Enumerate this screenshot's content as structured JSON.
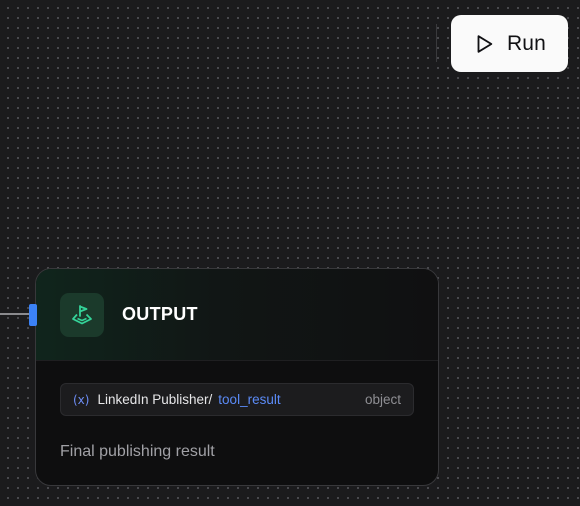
{
  "toolbar": {
    "run_label": "Run"
  },
  "node": {
    "title": "OUTPUT",
    "icon": "flag-icon",
    "variable": {
      "source": "LinkedIn Publisher/",
      "field": "tool_result",
      "type": "object"
    },
    "description": "Final publishing result"
  },
  "colors": {
    "canvas_background": "#1b1b1d",
    "handle": "#3b82f6",
    "accent_green": "#34d399",
    "variable_field": "#5b8bf7"
  }
}
